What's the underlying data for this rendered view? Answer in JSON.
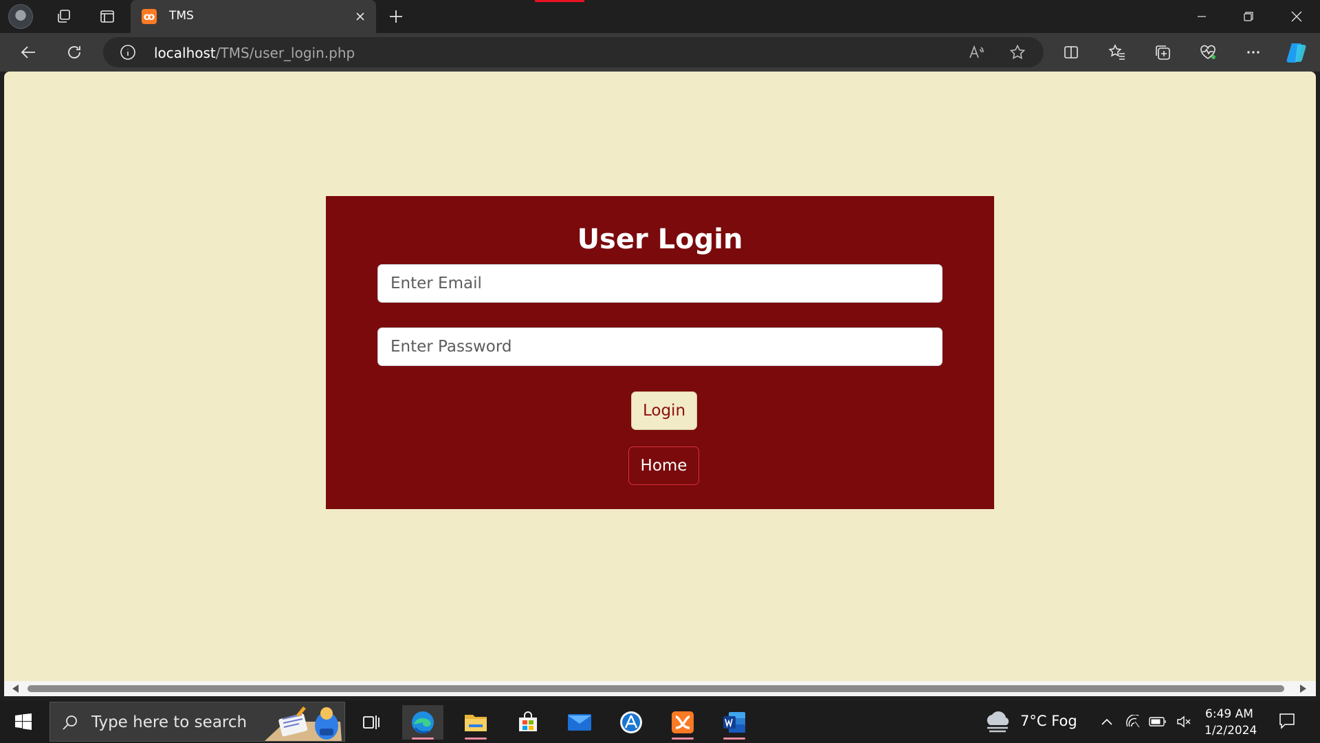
{
  "tab": {
    "title": "TMS",
    "favicon_letter": "ꝏ"
  },
  "address": {
    "host": "localhost",
    "path": "/TMS/user_login.php"
  },
  "page": {
    "title": "User Login",
    "email_placeholder": "Enter Email",
    "password_placeholder": "Enter Password",
    "login_label": "Login",
    "home_label": "Home"
  },
  "taskbar": {
    "search_placeholder": "Type here to search",
    "weather": "7°C  Fog",
    "time": "6:49 AM",
    "date": "1/2/2024"
  },
  "colors": {
    "page_bg": "#f2ebc7",
    "panel_bg": "#7a0a0c",
    "login_text": "#8b0e0e",
    "home_border": "#d8303a"
  },
  "icons": {
    "browser": [
      "avatar",
      "workspaces-icon",
      "tab-actions-icon",
      "close-icon",
      "plus-icon",
      "minimize-icon",
      "restore-icon",
      "window-close-icon",
      "back-icon",
      "refresh-icon",
      "info-icon",
      "read-aloud-icon",
      "star-icon",
      "split-screen-icon",
      "favorites-icon",
      "collections-icon",
      "browser-essentials-icon",
      "more-icon",
      "copilot-icon"
    ],
    "taskbar": [
      "windows-start-icon",
      "search-icon",
      "task-view-icon",
      "edge-icon",
      "file-explorer-icon",
      "microsoft-store-icon",
      "mail-icon",
      "app-store-icon",
      "xampp-icon",
      "word-icon",
      "cloud-icon",
      "chevron-up-icon",
      "wifi-icon",
      "battery-icon",
      "mute-icon",
      "notification-icon"
    ]
  }
}
